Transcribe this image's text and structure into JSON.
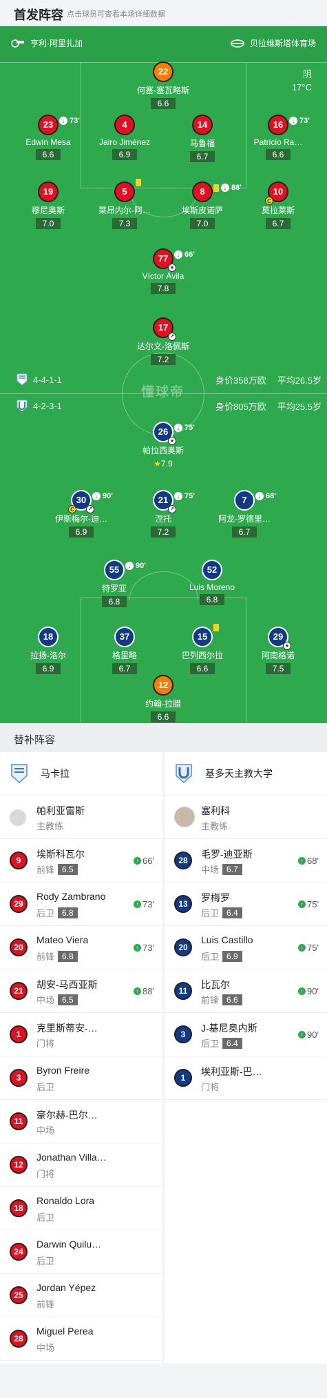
{
  "header": {
    "title": "首发阵容",
    "subtitle": "点击球员可查看本场详细数据"
  },
  "venue": {
    "coach_left": "亨利·阿里扎加",
    "stadium": "贝拉维斯塔体育场"
  },
  "weather": {
    "cond": "阴",
    "temp": "17°C"
  },
  "watermark": "懂球帝",
  "home": {
    "formation": "4-4-1-1",
    "value": "身价358万欧",
    "avg_age": "平均26.5岁"
  },
  "away": {
    "formation": "4-2-3-1",
    "value": "身价805万欧",
    "avg_age": "平均25.5岁"
  },
  "home_players": [
    {
      "num": "22",
      "name": "何塞-塞瓦略斯",
      "rating": "6.6",
      "gk": true
    },
    {
      "num": "23",
      "name": "Edwin Mesa",
      "rating": "6.6",
      "sub": "73'"
    },
    {
      "num": "4",
      "name": "Jairo Jiménez",
      "rating": "6.9"
    },
    {
      "num": "14",
      "name": "马鲁福",
      "rating": "6.7"
    },
    {
      "num": "16",
      "name": "Patricio Ra…",
      "rating": "6.6",
      "sub": "73'"
    },
    {
      "num": "19",
      "name": "穆尼奥斯",
      "rating": "7.0"
    },
    {
      "num": "5",
      "name": "莱昂内尔-阿…",
      "rating": "7.3",
      "yc": true
    },
    {
      "num": "8",
      "name": "埃斯皮诺萨",
      "rating": "7.0",
      "yc": true,
      "sub": "88'"
    },
    {
      "num": "10",
      "name": "莫拉莱斯",
      "rating": "6.7",
      "cap": true
    },
    {
      "num": "77",
      "name": "Víctor Ávila",
      "rating": "7.8",
      "sub": "66'",
      "goal": true
    },
    {
      "num": "17",
      "name": "达尔文-洛佩斯",
      "rating": "7.2",
      "assist": true
    }
  ],
  "away_players": [
    {
      "num": "26",
      "name": "帕拉西奥斯",
      "rating": "7.9",
      "sub": "75'",
      "goal": true,
      "best": true
    },
    {
      "num": "30",
      "name": "伊斯梅尔-迪…",
      "rating": "6.9",
      "sub": "90'",
      "cap": true,
      "assist": true
    },
    {
      "num": "21",
      "name": "涅托",
      "rating": "7.2",
      "sub": "75'",
      "assist": true
    },
    {
      "num": "7",
      "name": "阿龙-罗德里…",
      "rating": "6.7",
      "sub": "68'"
    },
    {
      "num": "55",
      "name": "特罗亚",
      "rating": "6.8",
      "sub": "90'"
    },
    {
      "num": "52",
      "name": "Luis Moreno",
      "rating": "6.8"
    },
    {
      "num": "18",
      "name": "拉扬-洛尔",
      "rating": "6.9"
    },
    {
      "num": "37",
      "name": "格里略",
      "rating": "6.7"
    },
    {
      "num": "15",
      "name": "巴列西尔拉",
      "rating": "6.6",
      "yc": true
    },
    {
      "num": "29",
      "name": "阿南格诺",
      "rating": "7.5",
      "goal": true
    },
    {
      "num": "12",
      "name": "约翰-拉腊",
      "rating": "6.6",
      "gk": true
    }
  ],
  "bench": {
    "title": "替补阵容",
    "left": {
      "team": "马卡拉",
      "coach": "帕利亚雷斯",
      "coach_role": "主教练",
      "players": [
        {
          "num": "9",
          "name": "埃斯科瓦尔",
          "pos": "前锋",
          "rating": "6.5",
          "in": "66'"
        },
        {
          "num": "29",
          "name": "Rody Zambrano",
          "pos": "后卫",
          "rating": "6.8",
          "in": "73'"
        },
        {
          "num": "20",
          "name": "Mateo Viera",
          "pos": "前锋",
          "rating": "6.8",
          "in": "73'"
        },
        {
          "num": "21",
          "name": "胡安-马西亚斯",
          "pos": "中场",
          "rating": "6.5",
          "in": "88'"
        },
        {
          "num": "1",
          "name": "克里斯蒂安-…",
          "pos": "门将"
        },
        {
          "num": "3",
          "name": "Byron Freire",
          "pos": "后卫"
        },
        {
          "num": "11",
          "name": "豪尔赫-巴尔…",
          "pos": "中场"
        },
        {
          "num": "12",
          "name": "Jonathan Villa…",
          "pos": "门将"
        },
        {
          "num": "18",
          "name": "Ronaldo Lora",
          "pos": "后卫"
        },
        {
          "num": "24",
          "name": "Darwin Quilu…",
          "pos": "后卫"
        },
        {
          "num": "25",
          "name": "Jordan Yépez",
          "pos": "前锋"
        },
        {
          "num": "28",
          "name": "Miguel Perea",
          "pos": "中场"
        }
      ]
    },
    "right": {
      "team": "基多天主教大学",
      "coach": "塞利科",
      "coach_role": "主教练",
      "players": [
        {
          "num": "28",
          "name": "毛罗-迪亚斯",
          "pos": "中场",
          "rating": "6.7",
          "in": "68'"
        },
        {
          "num": "13",
          "name": "罗梅罗",
          "pos": "后卫",
          "rating": "6.4",
          "in": "75'"
        },
        {
          "num": "20",
          "name": "Luis Castillo",
          "pos": "后卫",
          "rating": "6.9",
          "in": "75'"
        },
        {
          "num": "11",
          "name": "比瓦尔",
          "pos": "前锋",
          "rating": "6.6",
          "in": "90'"
        },
        {
          "num": "3",
          "name": "J-基尼奥内斯",
          "pos": "后卫",
          "rating": "6.4",
          "in": "90'"
        },
        {
          "num": "1",
          "name": "埃利亚斯-巴…",
          "pos": "门将"
        }
      ]
    }
  }
}
